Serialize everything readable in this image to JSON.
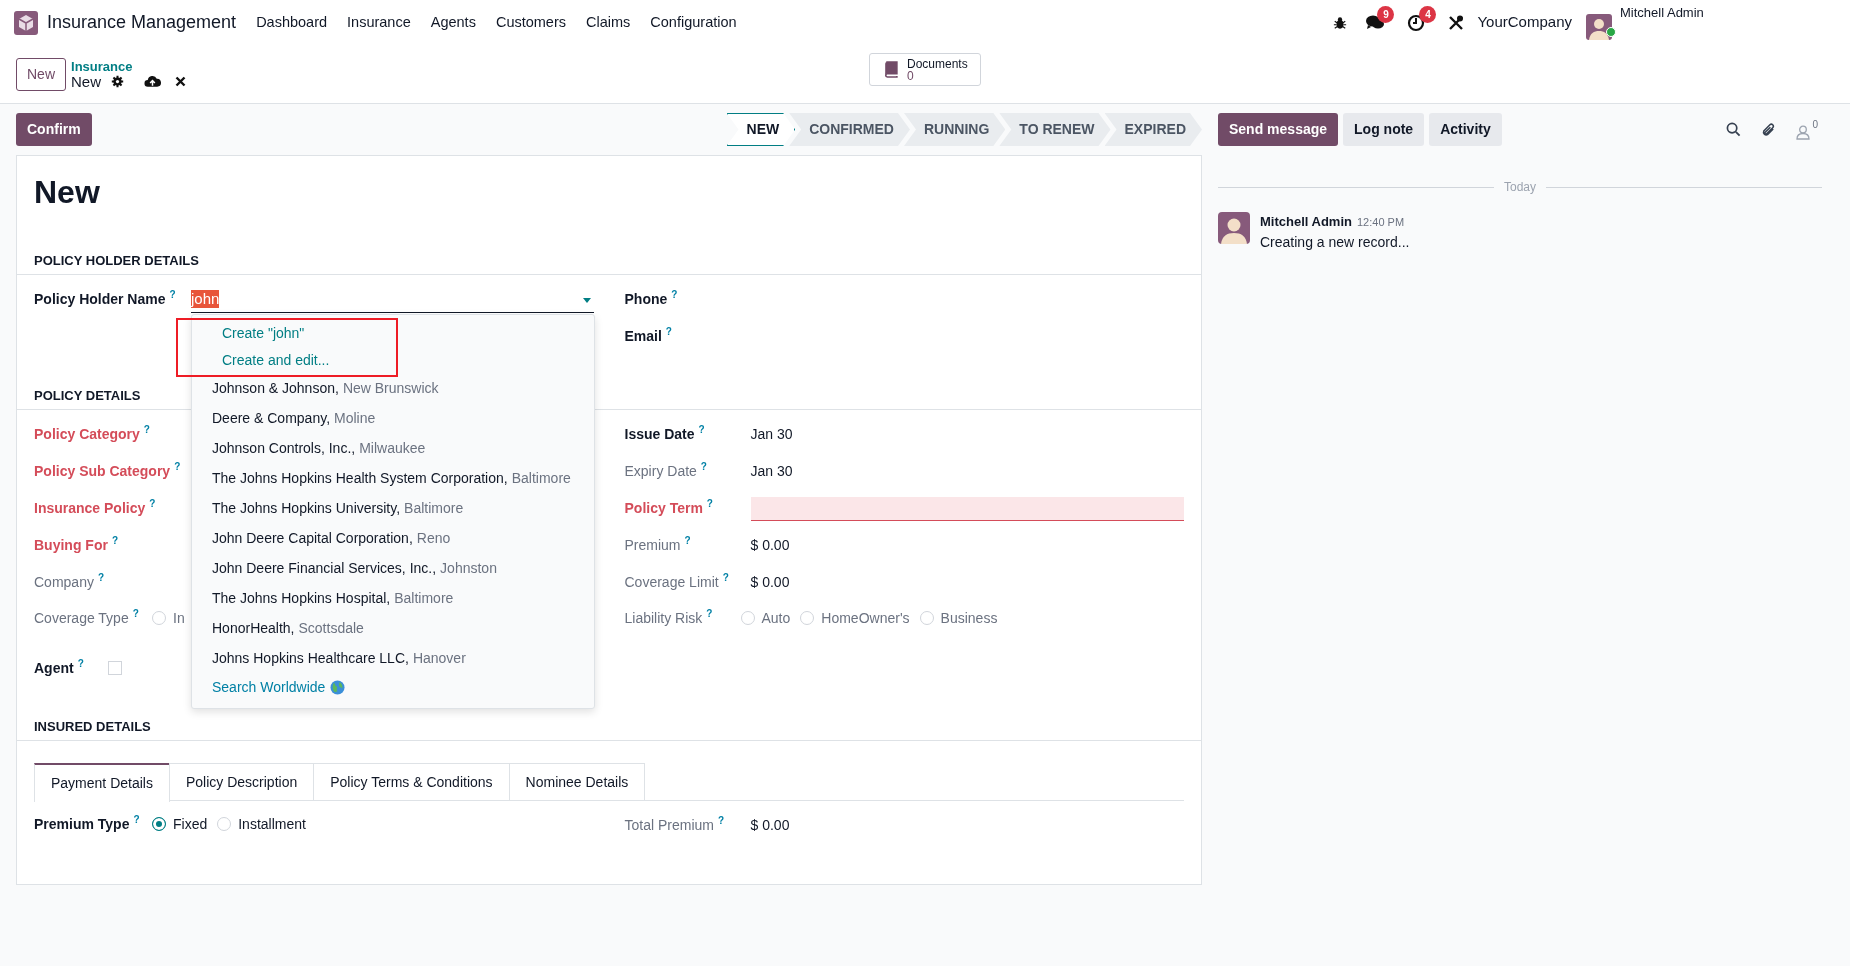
{
  "navbar": {
    "app_name": "Insurance Management",
    "menu": [
      "Dashboard",
      "Insurance",
      "Agents",
      "Customers",
      "Claims",
      "Configuration"
    ],
    "chat_badge": "9",
    "activity_badge": "4",
    "company": "YourCompany",
    "user": "Mitchell Admin"
  },
  "control_panel": {
    "new_button": "New",
    "breadcrumb": "Insurance",
    "record": "New",
    "documents": {
      "label": "Documents",
      "count": "0"
    }
  },
  "status_bar": {
    "confirm": "Confirm",
    "stages": [
      {
        "label": "NEW",
        "selected": true
      },
      {
        "label": "CONFIRMED",
        "selected": false
      },
      {
        "label": "RUNNING",
        "selected": false
      },
      {
        "label": "TO RENEW",
        "selected": false
      },
      {
        "label": "EXPIRED",
        "selected": false
      }
    ]
  },
  "form": {
    "title": "New",
    "sections": [
      {
        "title": "POLICY HOLDER DETAILS",
        "left": [
          {
            "label": "Policy Holder Name",
            "help": "?",
            "required": false,
            "readonly": false,
            "kind": "many2one",
            "value": "john",
            "text_selected": true,
            "dropdown": {
              "highlight_create": true,
              "create_items": [
                "Create \"john\"",
                "Create and edit..."
              ],
              "records": [
                {
                  "name": "Johnson & Johnson,",
                  "city": "New Brunswick"
                },
                {
                  "name": "Deere & Company,",
                  "city": "Moline"
                },
                {
                  "name": "Johnson Controls, Inc.,",
                  "city": "Milwaukee"
                },
                {
                  "name": "The Johns Hopkins Health System Corporation,",
                  "city": "Baltimore"
                },
                {
                  "name": "The Johns Hopkins University,",
                  "city": "Baltimore"
                },
                {
                  "name": "John Deere Capital Corporation,",
                  "city": "Reno"
                },
                {
                  "name": "John Deere Financial Services, Inc.,",
                  "city": "Johnston"
                },
                {
                  "name": "The Johns Hopkins Hospital,",
                  "city": "Baltimore"
                },
                {
                  "name": "HonorHealth,",
                  "city": "Scottsdale"
                },
                {
                  "name": "Johns Hopkins Healthcare LLC,",
                  "city": "Hanover"
                }
              ],
              "search_more": "Search Worldwide"
            }
          }
        ],
        "right": [
          {
            "label": "Phone",
            "help": "?",
            "required": false,
            "readonly": false,
            "kind": "text"
          },
          {
            "label": "Email",
            "help": "?",
            "required": false,
            "readonly": false,
            "kind": "text"
          }
        ]
      },
      {
        "title": "POLICY DETAILS",
        "left": [
          {
            "label": "Policy Category",
            "help": "?",
            "required": true,
            "readonly": false,
            "kind": "text"
          },
          {
            "label": "Policy Sub Category",
            "help": "?",
            "required": true,
            "readonly": false,
            "kind": "text"
          },
          {
            "label": "Insurance Policy",
            "help": "?",
            "required": true,
            "readonly": false,
            "kind": "text"
          },
          {
            "label": "Buying For",
            "help": "?",
            "required": true,
            "readonly": false,
            "kind": "text"
          },
          {
            "label": "Company",
            "help": "?",
            "required": false,
            "readonly": true,
            "kind": "text"
          },
          {
            "label": "Coverage Type",
            "help": "?",
            "required": false,
            "readonly": true,
            "kind": "radio",
            "options": [
              {
                "label": "In",
                "selected": false
              }
            ]
          },
          {
            "label": "Agent",
            "help": "?",
            "required": false,
            "readonly": false,
            "kind": "checkbox",
            "checked": false
          }
        ],
        "right": [
          {
            "label": "Issue Date",
            "help": "?",
            "required": false,
            "readonly": false,
            "kind": "text",
            "value": "Jan 30"
          },
          {
            "label": "Expiry Date",
            "help": "?",
            "required": false,
            "readonly": true,
            "kind": "text",
            "value": "Jan 30"
          },
          {
            "label": "Policy Term",
            "help": "?",
            "required": true,
            "readonly": false,
            "kind": "input",
            "invalid": true
          },
          {
            "label": "Premium",
            "help": "?",
            "required": false,
            "readonly": true,
            "kind": "text",
            "value": "$ 0.00"
          },
          {
            "label": "Coverage Limit",
            "help": "?",
            "required": false,
            "readonly": true,
            "kind": "text",
            "value": "$ 0.00"
          },
          {
            "label": "Liability Risk",
            "help": "?",
            "required": false,
            "readonly": true,
            "kind": "radio",
            "options": [
              {
                "label": "Auto",
                "selected": false
              },
              {
                "label": "HomeOwner's",
                "selected": false
              },
              {
                "label": "Business",
                "selected": false
              }
            ]
          }
        ]
      },
      {
        "title": "INSURED DETAILS",
        "tabs": [
          {
            "label": "Payment Details",
            "selected": true
          },
          {
            "label": "Policy Description",
            "selected": false
          },
          {
            "label": "Policy Terms & Conditions",
            "selected": false
          },
          {
            "label": "Nominee Details",
            "selected": false
          }
        ],
        "left": [
          {
            "label": "Premium Type",
            "help": "?",
            "required": false,
            "readonly": false,
            "kind": "radio",
            "options": [
              {
                "label": "Fixed",
                "selected": true
              },
              {
                "label": "Installment",
                "selected": false
              }
            ]
          }
        ],
        "right": [
          {
            "label": "Total Premium",
            "help": "?",
            "required": false,
            "readonly": true,
            "kind": "text",
            "value": "$ 0.00"
          }
        ]
      }
    ]
  },
  "chatter": {
    "buttons": [
      {
        "label": "Send message",
        "selected": true
      },
      {
        "label": "Log note",
        "selected": false
      },
      {
        "label": "Activity",
        "selected": false
      }
    ],
    "followers": "0",
    "date_separator": "Today",
    "messages": [
      {
        "author": "Mitchell Admin",
        "time": "12:40 PM",
        "body": "Creating a new record..."
      }
    ]
  }
}
